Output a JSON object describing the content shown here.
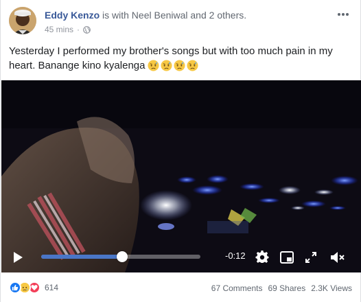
{
  "post": {
    "author": "Eddy Kenzo",
    "with_text": " is with Neel Beniwal and 2 others.",
    "time_ago": "45 mins",
    "separator": "·",
    "privacy_icon": "globe-icon",
    "text": "Yesterday I performed my brother's songs but with too much pain in my heart. Banange kino kyalenga",
    "emojis": [
      "sad-emoji",
      "sad-emoji",
      "sad-emoji",
      "sad-emoji"
    ]
  },
  "video": {
    "time_remaining": "-0:12",
    "progress": 0.51,
    "icons": {
      "play": "play-icon",
      "settings": "gear-icon",
      "pip": "picture-in-picture-icon",
      "fullscreen": "expand-icon",
      "mute": "volume-muted-icon"
    }
  },
  "footer": {
    "reaction_icons": [
      "like-icon",
      "sad-icon",
      "love-icon"
    ],
    "reaction_count": "614",
    "comments": "67 Comments",
    "shares": "69 Shares",
    "views": "2.3K Views"
  },
  "colors": {
    "author": "#385898",
    "progress_fill": "#4a76c7",
    "like": "#1877f2",
    "love": "#f33e58",
    "sad": "#f7b125"
  }
}
